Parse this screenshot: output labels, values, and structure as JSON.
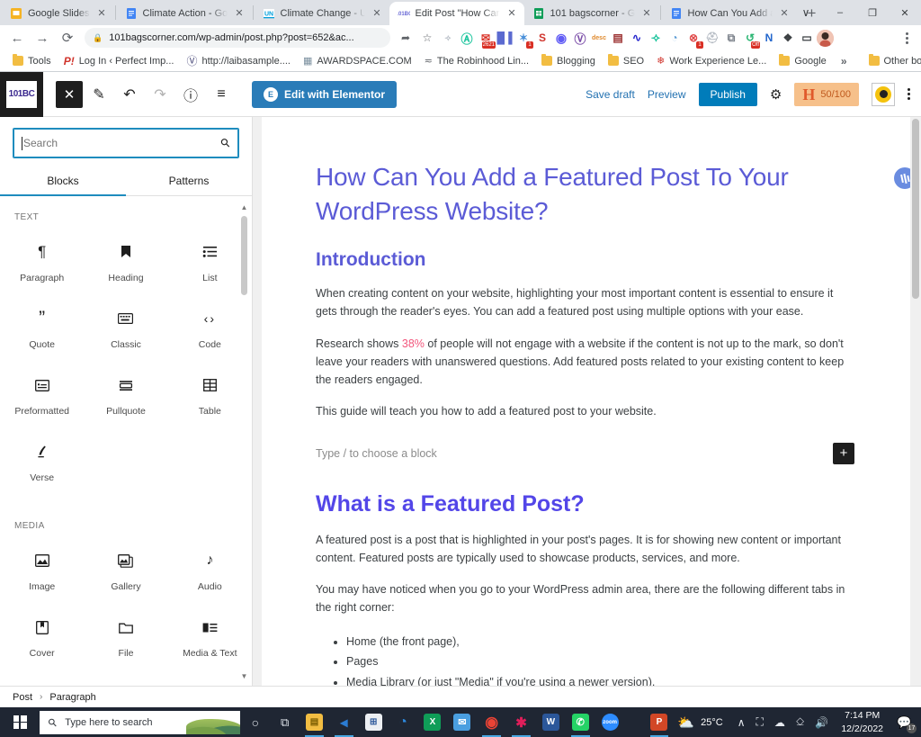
{
  "browser": {
    "tabs": [
      {
        "title": "Google Slides",
        "favicon": "slides-icon",
        "color": "#f5b324",
        "active": false
      },
      {
        "title": "Climate Action - Go",
        "favicon": "docs-icon",
        "color": "#4285f4",
        "active": false
      },
      {
        "title": "Climate Change - U",
        "favicon": "un-icon",
        "color": "#009edb",
        "active": false
      },
      {
        "title": "Edit Post \"How Can",
        "favicon": "wordpress-site-icon",
        "color": "#6b6bd6",
        "active": true
      },
      {
        "title": "101 bagscorner - G",
        "favicon": "sheets-icon",
        "color": "#0f9d58",
        "active": false
      },
      {
        "title": "How Can You Add a",
        "favicon": "docs-icon",
        "color": "#4285f4",
        "active": false
      }
    ],
    "new_tab_label": "+",
    "window_controls": {
      "tab_search": "∨",
      "minimize": "–",
      "maximize": "❐",
      "close": "✕"
    },
    "nav": {
      "back": "←",
      "forward": "→",
      "reload": "⟳",
      "url": "101bagscorner.com/wp-admin/post.php?post=652&ac...",
      "lock_icon": "lock-icon",
      "share_icon": "share-icon",
      "bookmark_icon": "star-icon",
      "menu_icon": "kebab-menu-icon"
    },
    "extensions": [
      {
        "name": "grammarly-extension",
        "glyph": "G",
        "color": "#15c39a",
        "badge": ""
      },
      {
        "name": "gmail-checker-extension",
        "glyph": "✉",
        "color": "#d93025",
        "badge": "2621"
      },
      {
        "name": "hotjar-extension",
        "glyph": "Ⅱ",
        "color": "#5b6ad0",
        "badge": ""
      },
      {
        "name": "sparkle-extension",
        "glyph": "✸",
        "color": "#4a90d9",
        "badge": "1"
      },
      {
        "name": "seo-extension",
        "glyph": "S",
        "color": "#d0342c",
        "badge": ""
      },
      {
        "name": "loom-extension",
        "glyph": "◉",
        "color": "#625df5",
        "badge": ""
      },
      {
        "name": "wordpress-extension",
        "glyph": "Ⓦ",
        "color": "#7b4ea8",
        "badge": ""
      },
      {
        "name": "desc-extension",
        "glyph": "desc",
        "color": "#e08a2e",
        "badge": ""
      },
      {
        "name": "clipboard-extension",
        "glyph": "▤",
        "color": "#9b3030",
        "badge": ""
      },
      {
        "name": "analytics-extension",
        "glyph": "∿",
        "color": "#2222cc",
        "badge": ""
      },
      {
        "name": "grammarly-alt-extension",
        "glyph": "G",
        "color": "#15c39a",
        "badge": ""
      },
      {
        "name": "wifi-extension",
        "glyph": "◔",
        "color": "#5b9bd5",
        "badge": ""
      },
      {
        "name": "keywords-extension",
        "glyph": "⊗",
        "color": "#e04a4a",
        "badge": "1"
      },
      {
        "name": "shield-extension",
        "glyph": "⛉",
        "color": "#b6bcc4",
        "badge": ""
      },
      {
        "name": "copy-extension",
        "glyph": "⧉",
        "color": "#7a8089",
        "badge": ""
      },
      {
        "name": "onoff-extension",
        "glyph": "↺",
        "color": "#2bb673",
        "badge": "Off"
      },
      {
        "name": "notion-extension",
        "glyph": "N",
        "color": "#2266cc",
        "badge": ""
      },
      {
        "name": "puzzle-extension",
        "glyph": "❖",
        "color": "#5f6368",
        "badge": ""
      },
      {
        "name": "sidepanel-extension",
        "glyph": "▭",
        "color": "#5f6368",
        "badge": ""
      }
    ],
    "bookmarks": [
      {
        "label": "Tools",
        "icon": "folder-icon"
      },
      {
        "label": "Log In ‹ Perfect Imp...",
        "icon": "p-icon"
      },
      {
        "label": "http://laibasample....",
        "icon": "wordpress-icon"
      },
      {
        "label": "AWARDSPACE.COM",
        "icon": "awardspace-icon"
      },
      {
        "label": "The Robinhood Lin...",
        "icon": "robinhood-icon"
      },
      {
        "label": "Blogging",
        "icon": "folder-icon"
      },
      {
        "label": "SEO",
        "icon": "folder-icon"
      },
      {
        "label": "Work Experience Le...",
        "icon": "maple-icon"
      },
      {
        "label": "Google",
        "icon": "folder-icon"
      }
    ],
    "bookmarks_overflow": "»",
    "other_bookmarks": {
      "label": "Other bookmarks",
      "icon": "folder-icon"
    }
  },
  "wordpress": {
    "logo_text": "101BC",
    "toolbar_icons": [
      {
        "name": "close-editor-button",
        "glyph": "✕"
      },
      {
        "name": "edit-pencil-icon",
        "glyph": "✎"
      },
      {
        "name": "undo-icon",
        "glyph": "↶"
      },
      {
        "name": "redo-icon",
        "glyph": "↷"
      },
      {
        "name": "info-icon",
        "glyph": "ⓘ"
      },
      {
        "name": "list-view-icon",
        "glyph": "≡"
      }
    ],
    "elementor_button": "Edit with Elementor",
    "save_draft": "Save draft",
    "preview": "Preview",
    "publish": "Publish",
    "settings_icon": "gear-icon",
    "seo_score": "50/100",
    "seo_mark": "H",
    "inserter": {
      "search_placeholder": "Search",
      "search_value": "",
      "search_icon": "search-icon",
      "tabs": [
        {
          "label": "Blocks",
          "active": true
        },
        {
          "label": "Patterns",
          "active": false
        }
      ],
      "categories": [
        {
          "label": "TEXT",
          "blocks": [
            {
              "label": "Paragraph",
              "icon": "paragraph-icon",
              "glyph": "¶"
            },
            {
              "label": "Heading",
              "icon": "heading-icon",
              "glyph": "⚑"
            },
            {
              "label": "List",
              "icon": "list-icon",
              "glyph": "☰"
            },
            {
              "label": "Quote",
              "icon": "quote-icon",
              "glyph": "”"
            },
            {
              "label": "Classic",
              "icon": "classic-icon",
              "glyph": "⌨"
            },
            {
              "label": "Code",
              "icon": "code-icon",
              "glyph": "‹›"
            },
            {
              "label": "Preformatted",
              "icon": "preformatted-icon",
              "glyph": "▣"
            },
            {
              "label": "Pullquote",
              "icon": "pullquote-icon",
              "glyph": "▭"
            },
            {
              "label": "Table",
              "icon": "table-icon",
              "glyph": "⊞"
            },
            {
              "label": "Verse",
              "icon": "verse-icon",
              "glyph": "✐"
            }
          ]
        },
        {
          "label": "MEDIA",
          "blocks": [
            {
              "label": "Image",
              "icon": "image-icon",
              "glyph": "⛰"
            },
            {
              "label": "Gallery",
              "icon": "gallery-icon",
              "glyph": "❐"
            },
            {
              "label": "Audio",
              "icon": "audio-icon",
              "glyph": "♪"
            },
            {
              "label": "Cover",
              "icon": "cover-icon",
              "glyph": "□"
            },
            {
              "label": "File",
              "icon": "file-icon",
              "glyph": "▱"
            },
            {
              "label": "Media & Text",
              "icon": "media-text-icon",
              "glyph": "■≡"
            }
          ]
        }
      ]
    },
    "post": {
      "title": "How Can You Add a Featured Post To Your WordPress Website?",
      "sections": [
        {
          "type": "h2",
          "text": "Introduction"
        },
        {
          "type": "p",
          "text": "When creating content on your website, highlighting your most important content is essential to ensure it gets through the reader's eyes. You can add a featured post using multiple options with your ease."
        },
        {
          "type": "p-highlight",
          "before": "Research shows ",
          "highlight": "38%",
          "after": " of people will not engage with a website if the content is not up to the mark, so don't leave your readers with unanswered questions. Add featured posts related to your existing content to keep the readers engaged."
        },
        {
          "type": "p",
          "text": "This guide will teach you how to add a featured post to your website."
        },
        {
          "type": "placeholder",
          "text": "Type / to choose a block"
        },
        {
          "type": "h2-big",
          "text": "What is a Featured Post?"
        },
        {
          "type": "p",
          "text": "A featured post is a post that is highlighted in your post's pages. It is for showing new content or important content. Featured posts are typically used to showcase products, services, and more."
        },
        {
          "type": "p",
          "text": "You may have noticed when you go to your WordPress admin area, there are the following different tabs in the right corner:"
        }
      ],
      "bullets": [
        "Home (the front page),",
        "Pages",
        "Media Library (or just \"Media\" if you're using a newer version)."
      ],
      "add_block_label": "+",
      "float_badge": "grammarly-float-icon"
    },
    "breadcrumb": [
      {
        "label": "Post"
      },
      {
        "label": "Paragraph"
      }
    ],
    "breadcrumb_separator": "›"
  },
  "taskbar": {
    "start_icon": "windows-start-icon",
    "search_placeholder": "Type here to search",
    "items": [
      {
        "name": "cortana-icon",
        "glyph": "○",
        "color": "transparent"
      },
      {
        "name": "task-view-icon",
        "glyph": "⧉",
        "color": "transparent"
      },
      {
        "name": "file-explorer-icon",
        "glyph": "▤",
        "color": "#f2bd42"
      },
      {
        "name": "vscode-icon",
        "glyph": "◁",
        "color": "#2b7cd3"
      },
      {
        "name": "microsoft-store-icon",
        "glyph": "⊞",
        "color": "#e8eaed"
      },
      {
        "name": "edge-icon",
        "glyph": "◔",
        "color": "#2d8ae0"
      },
      {
        "name": "excel-icon",
        "glyph": "X",
        "color": "#0f9d58"
      },
      {
        "name": "mail-icon",
        "glyph": "✉",
        "color": "#4a9fe0"
      },
      {
        "name": "chrome-icon",
        "glyph": "◎",
        "color": "#ea4335"
      },
      {
        "name": "slack-icon",
        "glyph": "✱",
        "color": "#e01e5a"
      },
      {
        "name": "word-icon",
        "glyph": "W",
        "color": "#2b579a"
      },
      {
        "name": "whatsapp-icon",
        "glyph": "✆",
        "color": "#25d366"
      },
      {
        "name": "zoom-icon",
        "glyph": "zoom",
        "color": "#2d8cff"
      },
      {
        "name": "powerpoint-icon",
        "glyph": "P",
        "color": "#d24726"
      }
    ],
    "weather": {
      "icon": "partly-cloudy-icon",
      "temp": "25°C"
    },
    "tray": [
      {
        "name": "show-hidden-icons",
        "glyph": "∧"
      },
      {
        "name": "camera-tray-icon",
        "glyph": "⛶"
      },
      {
        "name": "onedrive-icon",
        "glyph": "☁"
      },
      {
        "name": "network-icon",
        "glyph": "⎐"
      },
      {
        "name": "volume-icon",
        "glyph": "ᴘ"
      }
    ],
    "clock": {
      "time": "7:14 PM",
      "date": "12/2/2022"
    },
    "notifications": {
      "icon": "action-center-icon",
      "count": "17"
    }
  },
  "colors": {
    "accent_blue": "#007cba",
    "wp_purple": "#5b5bd6",
    "highlight_pink": "#f2567c",
    "chrome_bg": "#dee1e6",
    "taskbar_bg": "#1f2633"
  }
}
